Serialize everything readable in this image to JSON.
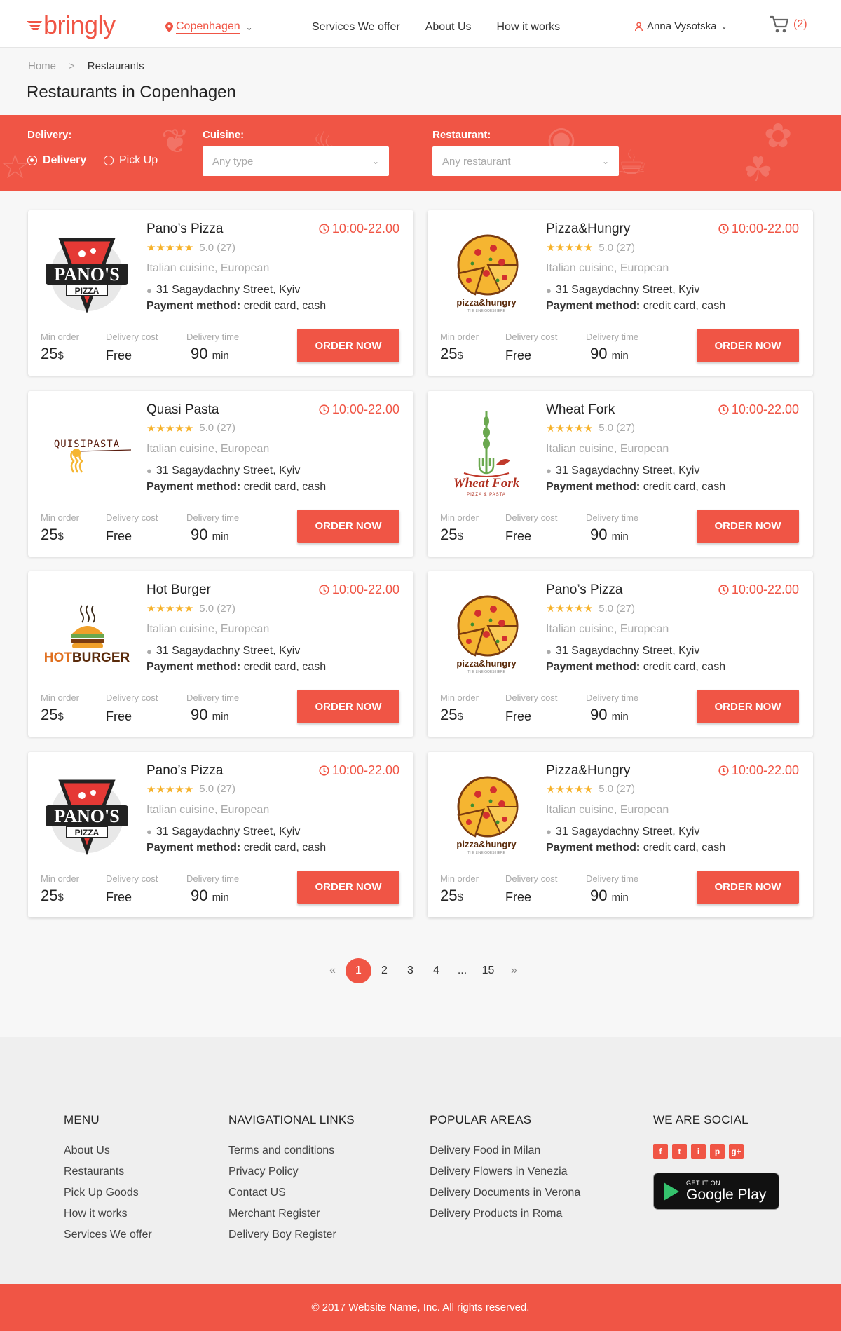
{
  "header": {
    "logo": "bringly",
    "city": "Copenhagen",
    "nav": [
      "Services  We offer",
      "About Us",
      "How it works"
    ],
    "user": "Anna Vysotska",
    "cart_count": "(2)"
  },
  "breadcrumb": {
    "home": "Home",
    "separator": ">",
    "current": "Restaurants"
  },
  "page_title": "Restaurants in Copenhagen",
  "filters": {
    "delivery_label": "Delivery:",
    "delivery_option": "Delivery",
    "pickup_option": "Pick Up",
    "cuisine_label": "Cuisine:",
    "cuisine_value": "Any type",
    "restaurant_label": "Restaurant:",
    "restaurant_value": "Any restaurant"
  },
  "card_labels": {
    "min_order": "Min order",
    "delivery_cost": "Delivery cost",
    "delivery_time": "Delivery time",
    "order_now": "ORDER NOW",
    "payment_label": "Payment method:"
  },
  "restaurants": [
    {
      "name": "Pano’s Pizza",
      "logo": "panos",
      "hours": "10:00-22.00",
      "stars": "★★★★★",
      "rating": "5.0 (27)",
      "cuisine": "Italian cuisine, European",
      "address": "31 Sagaydachny Street, Kyiv",
      "payment": "credit card, cash",
      "min_order": "25",
      "currency": "$",
      "delivery_cost": "Free",
      "delivery_time": "90",
      "time_unit": "min"
    },
    {
      "name": "Pizza&Hungry",
      "logo": "pizzahungry",
      "hours": "10:00-22.00",
      "stars": "★★★★★",
      "rating": "5.0 (27)",
      "cuisine": "Italian cuisine, European",
      "address": "31 Sagaydachny Street, Kyiv",
      "payment": "credit card, cash",
      "min_order": "25",
      "currency": "$",
      "delivery_cost": "Free",
      "delivery_time": "90",
      "time_unit": "min"
    },
    {
      "name": "Quasi Pasta",
      "logo": "quasipasta",
      "hours": "10:00-22.00",
      "stars": "★★★★★",
      "rating": "5.0 (27)",
      "cuisine": "Italian cuisine, European",
      "address": "31 Sagaydachny Street, Kyiv",
      "payment": "credit card, cash",
      "min_order": "25",
      "currency": "$",
      "delivery_cost": "Free",
      "delivery_time": "90",
      "time_unit": "min"
    },
    {
      "name": "Wheat Fork",
      "logo": "wheatfork",
      "hours": "10:00-22.00",
      "stars": "★★★★★",
      "rating": "5.0 (27)",
      "cuisine": "Italian cuisine, European",
      "address": "31 Sagaydachny Street, Kyiv",
      "payment": "credit card, cash",
      "min_order": "25",
      "currency": "$",
      "delivery_cost": "Free",
      "delivery_time": "90",
      "time_unit": "min"
    },
    {
      "name": "Hot Burger",
      "logo": "hotburger",
      "hours": "10:00-22.00",
      "stars": "★★★★★",
      "rating": "5.0 (27)",
      "cuisine": "Italian cuisine, European",
      "address": "31 Sagaydachny Street, Kyiv",
      "payment": "credit card, cash",
      "min_order": "25",
      "currency": "$",
      "delivery_cost": "Free",
      "delivery_time": "90",
      "time_unit": "min"
    },
    {
      "name": "Pano’s Pizza",
      "logo": "pizzahungry",
      "hours": "10:00-22.00",
      "stars": "★★★★★",
      "rating": "5.0 (27)",
      "cuisine": "Italian cuisine, European",
      "address": "31 Sagaydachny Street, Kyiv",
      "payment": "credit card, cash",
      "min_order": "25",
      "currency": "$",
      "delivery_cost": "Free",
      "delivery_time": "90",
      "time_unit": "min"
    },
    {
      "name": "Pano’s Pizza",
      "logo": "panos",
      "hours": "10:00-22.00",
      "stars": "★★★★★",
      "rating": "5.0 (27)",
      "cuisine": "Italian cuisine, European",
      "address": "31 Sagaydachny Street, Kyiv",
      "payment": "credit card, cash",
      "min_order": "25",
      "currency": "$",
      "delivery_cost": "Free",
      "delivery_time": "90",
      "time_unit": "min"
    },
    {
      "name": "Pizza&Hungry",
      "logo": "pizzahungry",
      "hours": "10:00-22.00",
      "stars": "★★★★★",
      "rating": "5.0 (27)",
      "cuisine": "Italian cuisine, European",
      "address": "31 Sagaydachny Street, Kyiv",
      "payment": "credit card, cash",
      "min_order": "25",
      "currency": "$",
      "delivery_cost": "Free",
      "delivery_time": "90",
      "time_unit": "min"
    }
  ],
  "logo_texts": {
    "panos_top": "PANO'S",
    "panos_bottom": "PIZZA",
    "pizzahungry": "pizza&hungry",
    "pizzahungry_tag": "THE LINE GOES HERE",
    "quasipasta": "QUISIPASTA",
    "wheatfork": "Wheat Fork",
    "wheatfork_tag": "PIZZA & PASTA",
    "hotburger_hot": "HOT",
    "hotburger_burger": "BURGER"
  },
  "pagination": {
    "prev": "«",
    "pages": [
      "1",
      "2",
      "3",
      "4",
      "...",
      "15"
    ],
    "next": "»",
    "active": "1"
  },
  "footer": {
    "menu_title": "MENU",
    "menu": [
      "About Us",
      "Restaurants",
      "Pick Up Goods",
      "How it works",
      "Services We offer"
    ],
    "nav_title": "NAVIGATIONAL LINKS",
    "nav": [
      "Terms and conditions",
      "Privacy Policy",
      "Contact US",
      "Merchant Register",
      "Delivery Boy Register"
    ],
    "areas_title": "POPULAR AREAS",
    "areas": [
      "Delivery Food in Milan",
      "Delivery Flowers in Venezia",
      "Delivery Documents in Verona",
      "Delivery Products in Roma"
    ],
    "social_title": "WE ARE SOCIAL",
    "social": [
      "f",
      "t",
      "i",
      "p",
      "g+"
    ],
    "store_small": "GET IT ON",
    "store_big": "Google Play",
    "copyright": "© 2017 Website Name, Inc. All rights reserved."
  },
  "colors": {
    "accent": "#f05545",
    "star": "#f6b22b"
  }
}
